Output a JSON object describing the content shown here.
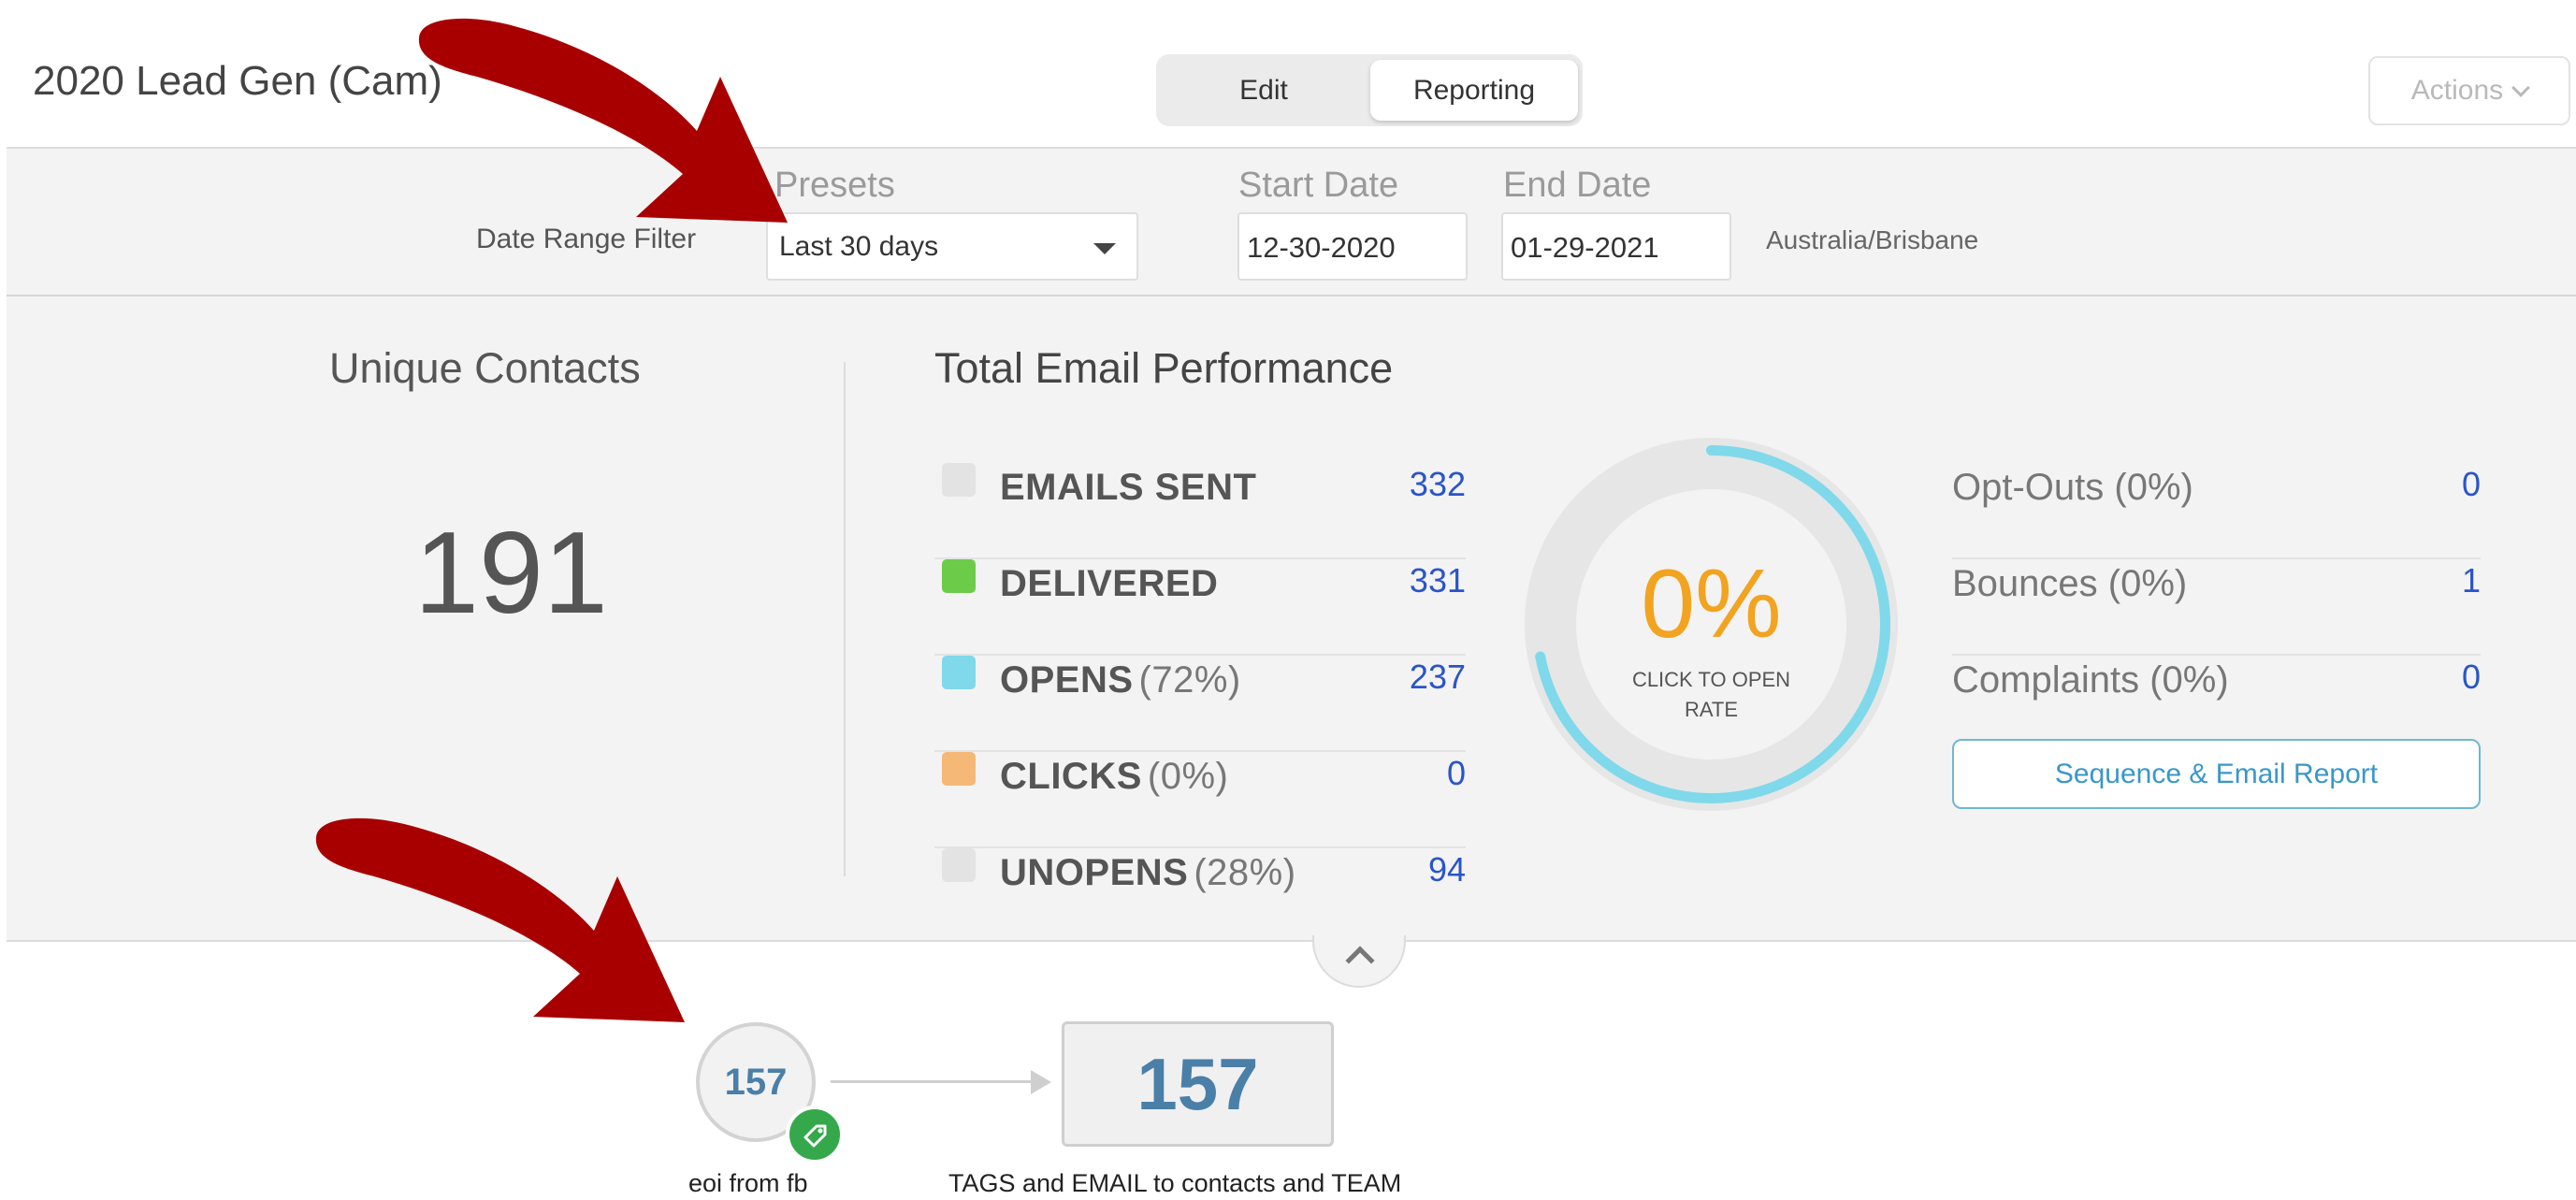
{
  "header": {
    "title": "2020 Lead Gen (Cam)",
    "tabs": [
      {
        "label": "Edit",
        "active": false
      },
      {
        "label": "Reporting",
        "active": true
      }
    ],
    "actions_label": "Actions"
  },
  "filters": {
    "date_range_label": "Date Range Filter",
    "presets_label": "Presets",
    "presets_value": "Last 30 days",
    "start_label": "Start Date",
    "start_value": "12-30-2020",
    "end_label": "End Date",
    "end_value": "01-29-2021",
    "timezone": "Australia/Brisbane"
  },
  "unique_contacts": {
    "title": "Unique Contacts",
    "value": "191"
  },
  "email_performance": {
    "title": "Total Email Performance",
    "metrics": [
      {
        "name": "EMAILS SENT",
        "pct": "",
        "value": "332",
        "color": "#e3e3e3"
      },
      {
        "name": "DELIVERED",
        "pct": "",
        "value": "331",
        "color": "#6ccc4a"
      },
      {
        "name": "OPENS",
        "pct": "(72%)",
        "value": "237",
        "color": "#7fd9ea"
      },
      {
        "name": "CLICKS",
        "pct": "(0%)",
        "value": "0",
        "color": "#f5b877"
      },
      {
        "name": "UNOPENS",
        "pct": "(28%)",
        "value": "94",
        "color": "#e3e3e3"
      }
    ],
    "donut": {
      "value": "0%",
      "caption": "CLICK TO OPEN RATE",
      "fill_fraction": 0.72,
      "ring_color": "#7fd9ea",
      "track_color": "#e6e6e6"
    },
    "side_metrics": [
      {
        "name": "Opt-Outs (0%)",
        "value": "0"
      },
      {
        "name": "Bounces (0%)",
        "value": "1"
      },
      {
        "name": "Complaints (0%)",
        "value": "0"
      }
    ],
    "report_button": "Sequence & Email Report"
  },
  "flow": {
    "source_count": "157",
    "source_label": "eoi from fb",
    "sequence_count": "157",
    "sequence_label": "TAGS and EMAIL to contacts and TEAM"
  },
  "colors": {
    "accent_blue": "#2a55c8",
    "highlight_orange": "#f2a320",
    "annotation_red": "#a80000"
  }
}
